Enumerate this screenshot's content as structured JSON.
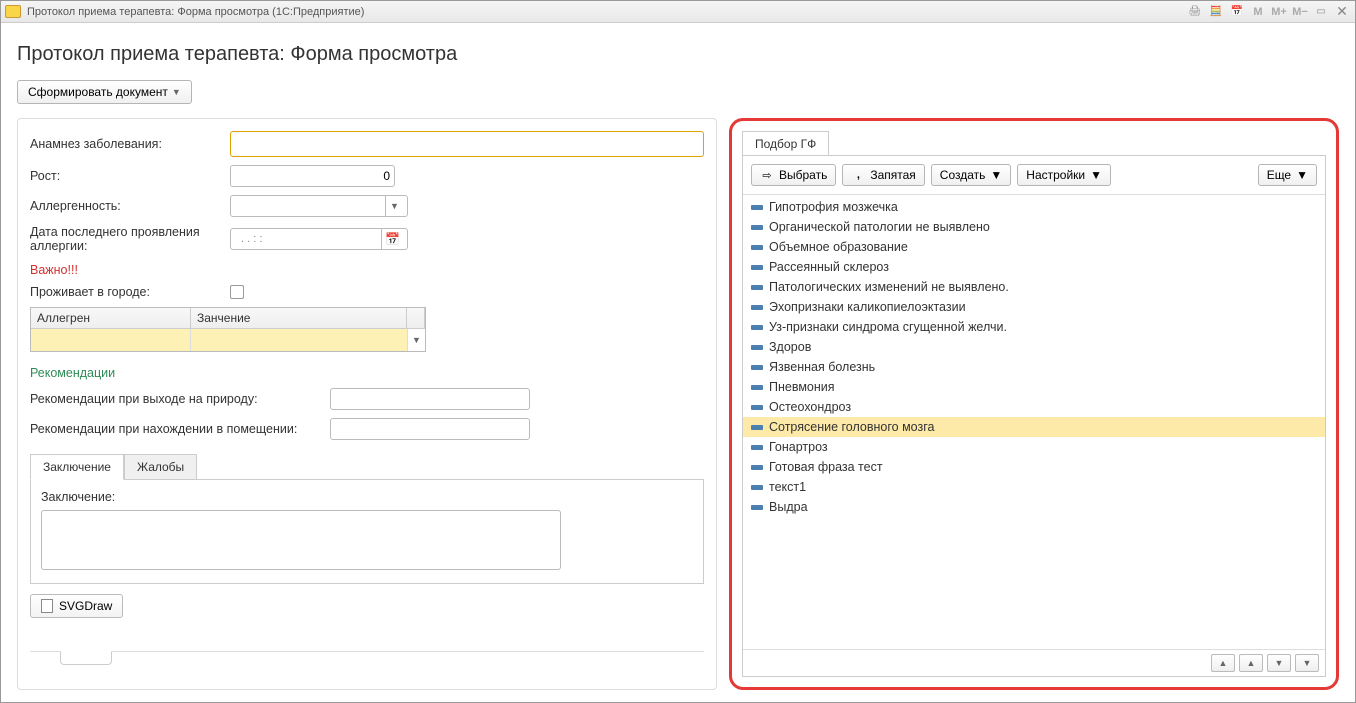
{
  "titlebar": {
    "text": "Протокол приема терапевта: Форма просмотра  (1С:Предприятие)"
  },
  "page": {
    "title": "Протокол приема терапевта: Форма просмотра"
  },
  "toolbar": {
    "form_doc": "Сформировать документ"
  },
  "form": {
    "anamnesis_label": "Анамнез заболевания:",
    "anamnesis_value": "",
    "height_label": "Рост:",
    "height_value": "0",
    "allergy_label": "Аллергенность:",
    "allergy_value": "",
    "allergy_date_label": "Дата последнего проявления аллергии:",
    "allergy_date_value": ". .   : :",
    "important": "Важно!!!",
    "city_label": "Проживает в городе:",
    "grid": {
      "col1": "Аллегрен",
      "col2": "Занчение"
    },
    "recs_title": "Рекомендации",
    "rec_outdoor_label": "Рекомендации при выходе на природу:",
    "rec_indoor_label": "Рекомендации при нахождении в помещении:",
    "tabs": {
      "conclusion": "Заключение",
      "complaints": "Жалобы"
    },
    "conclusion_label": "Заключение:",
    "conclusion_value": "",
    "svgdraw": "SVGDraw"
  },
  "right": {
    "tab": "Подбор ГФ",
    "buttons": {
      "select": "Выбрать",
      "comma": "Запятая",
      "create": "Создать",
      "settings": "Настройки",
      "more": "Еще"
    },
    "items": [
      "Гипотрофия мозжечка",
      "Органической патологии не выявлено",
      "Объемное образование",
      "Рассеянный склероз",
      "Патологических изменений не выявлено.",
      "Эхопризнаки каликопиелоэктазии",
      "Уз-признаки синдрома сгущенной желчи.",
      "Здоров",
      "Язвенная болезнь",
      "Пневмония",
      "Остеохондроз",
      "Сотрясение головного мозга",
      "Гонартроз",
      "Готовая фраза тест",
      "текст1",
      "Выдра"
    ],
    "selected_index": 11
  }
}
